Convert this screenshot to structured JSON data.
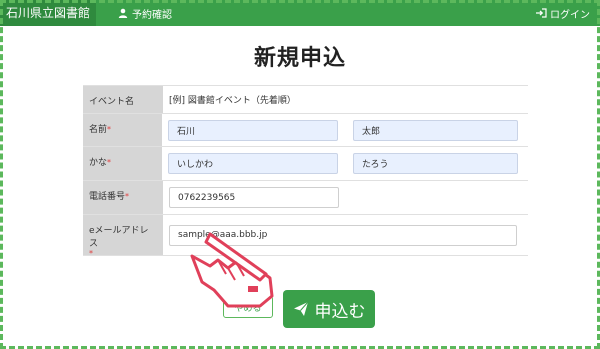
{
  "header": {
    "brand": "石川県立図書館",
    "reservation_label": "予約確認",
    "login_label": "ログイン"
  },
  "page": {
    "title": "新規申込"
  },
  "form": {
    "event": {
      "label": "イベント名",
      "value": "[例] 図書館イベント（先着順）"
    },
    "name": {
      "label": "名前",
      "required_mark": "*",
      "last": "石川",
      "first": "太郎"
    },
    "kana": {
      "label": "かな",
      "required_mark": "*",
      "last": "いしかわ",
      "first": "たろう"
    },
    "phone": {
      "label": "電話番号",
      "required_mark": "*",
      "value": "0762239565"
    },
    "email": {
      "label": "eメールアドレス",
      "required_mark": "*",
      "value": "sample@aaa.bbb.jp"
    }
  },
  "actions": {
    "cancel_label": "やめる",
    "submit_label": "申込む"
  },
  "colors": {
    "brand_green": "#3aa04a",
    "required_red": "#e04040",
    "hand_outline": "#e0405a"
  },
  "icons": {
    "reservation": "user-icon",
    "login": "login-icon",
    "submit": "paper-plane-icon",
    "pointer": "pointing-hand-icon"
  }
}
